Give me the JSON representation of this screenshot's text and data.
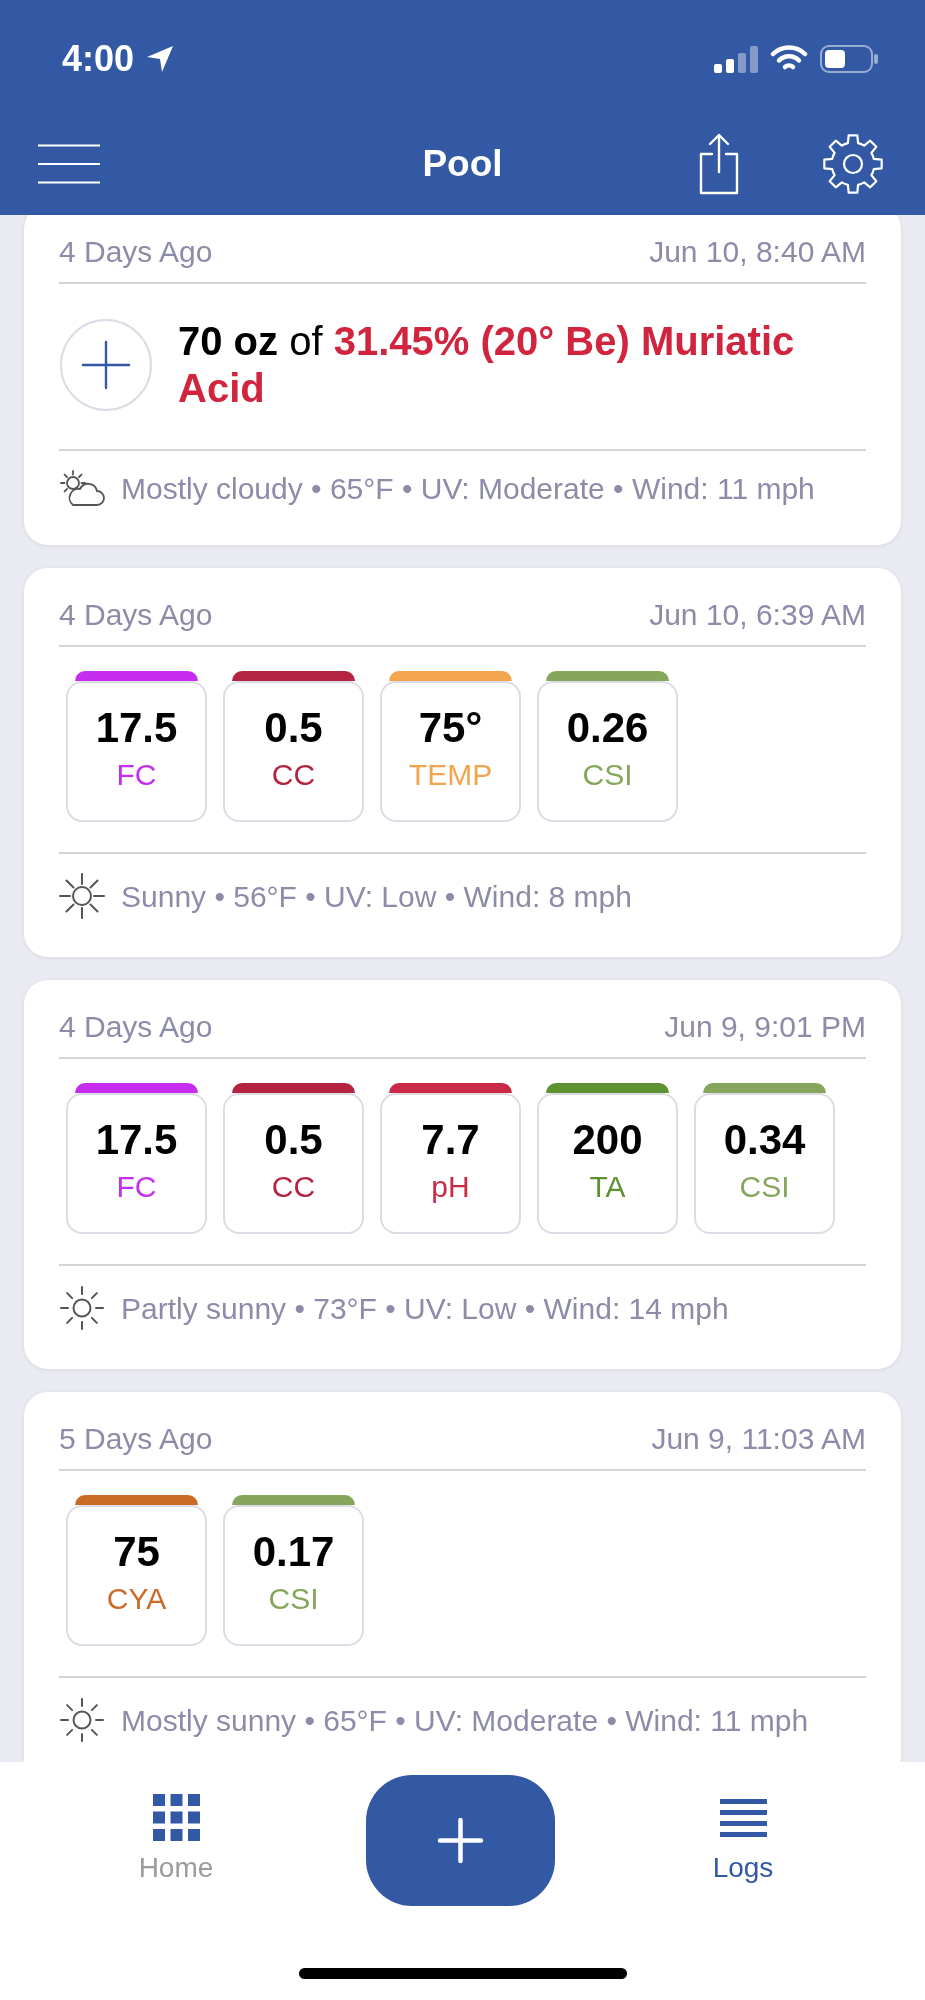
{
  "status_bar": {
    "time": "4:00"
  },
  "header": {
    "title": "Pool"
  },
  "logs": [
    {
      "kind": "dose",
      "age": "4 Days Ago",
      "timestamp": "Jun 10, 8:40 AM",
      "dose": {
        "amount": "70 oz",
        "connector": "of",
        "chemical": "31.45% (20° Be) Muriatic Acid"
      },
      "weather": {
        "kind": "cloudy",
        "text": "Mostly cloudy • 65°F • UV: Moderate • Wind: 11 mph"
      }
    },
    {
      "kind": "readings",
      "age": "4 Days Ago",
      "timestamp": "Jun 10, 6:39 AM",
      "readings": [
        {
          "value": "17.5",
          "label": "FC",
          "color": "#c62df1"
        },
        {
          "value": "0.5",
          "label": "CC",
          "color": "#b42340"
        },
        {
          "value": "75°",
          "label": "TEMP",
          "color": "#f2a54e"
        },
        {
          "value": "0.26",
          "label": "CSI",
          "color": "#85a65b"
        }
      ],
      "weather": {
        "kind": "sunny",
        "text": "Sunny • 56°F • UV: Low • Wind: 8 mph"
      }
    },
    {
      "kind": "readings",
      "age": "4 Days Ago",
      "timestamp": "Jun 9, 9:01 PM",
      "readings": [
        {
          "value": "17.5",
          "label": "FC",
          "color": "#c62df1"
        },
        {
          "value": "0.5",
          "label": "CC",
          "color": "#b42340"
        },
        {
          "value": "7.7",
          "label": "pH",
          "color": "#cb2a46"
        },
        {
          "value": "200",
          "label": "TA",
          "color": "#5e9230"
        },
        {
          "value": "0.34",
          "label": "CSI",
          "color": "#86a65e"
        }
      ],
      "weather": {
        "kind": "fair",
        "text": "Partly sunny • 73°F • UV: Low • Wind: 14 mph"
      }
    },
    {
      "kind": "readings",
      "age": "5 Days Ago",
      "timestamp": "Jun 9, 11:03 AM",
      "readings": [
        {
          "value": "75",
          "label": "CYA",
          "color": "#c96c28"
        },
        {
          "value": "0.17",
          "label": "CSI",
          "color": "#85a65b"
        }
      ],
      "weather": {
        "kind": "fair",
        "text": "Mostly sunny • 65°F • UV: Moderate • Wind: 11 mph"
      }
    }
  ],
  "tab_bar": {
    "home": {
      "label": "Home",
      "selected": false
    },
    "logs": {
      "label": "Logs",
      "selected": true
    }
  }
}
